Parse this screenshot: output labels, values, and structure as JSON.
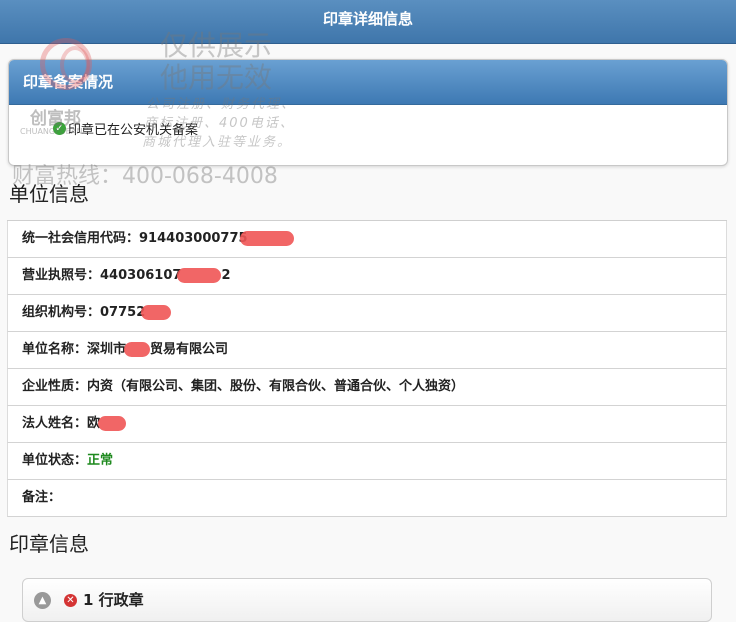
{
  "header": {
    "title": "印章详细信息"
  },
  "record_panel": {
    "title": "印章备案情况",
    "status_text": "印章已在公安机关备案"
  },
  "unit_section": {
    "title": "单位信息",
    "rows": [
      {
        "label": "统一社会信用代码：",
        "value": "914403000775"
      },
      {
        "label": "营业执照号：",
        "value": "440306107",
        "suffix": "2"
      },
      {
        "label": "组织机构号：",
        "value": "07752",
        "suffix": ""
      },
      {
        "label": "单位名称：",
        "value": "深圳市",
        "suffix": "贸易有限公司"
      },
      {
        "label": "企业性质：",
        "value": "内资（有限公司、集团、股份、有限合伙、普通合伙、个人独资）"
      },
      {
        "label": "法人姓名：",
        "value": "欧"
      },
      {
        "label": "单位状态：",
        "value": "正常"
      },
      {
        "label": "备注：",
        "value": ""
      }
    ]
  },
  "seal_section": {
    "title": "印章信息",
    "items": [
      {
        "label": "1 行政章"
      }
    ]
  },
  "watermark": {
    "line1": "仅供展示",
    "line2": "他用无效",
    "brand_cn": "创富邦",
    "brand_en": "CHUANGFUBANG",
    "services": [
      "公司注册、财务代理、",
      "商标注册、400电话、",
      "商城代理入驻等业务。"
    ],
    "hotline": "财富热线：400-068-4008"
  },
  "colors": {
    "accent": "#3f76ab",
    "status_ok": "#1f8a1f",
    "error": "#d43434"
  }
}
